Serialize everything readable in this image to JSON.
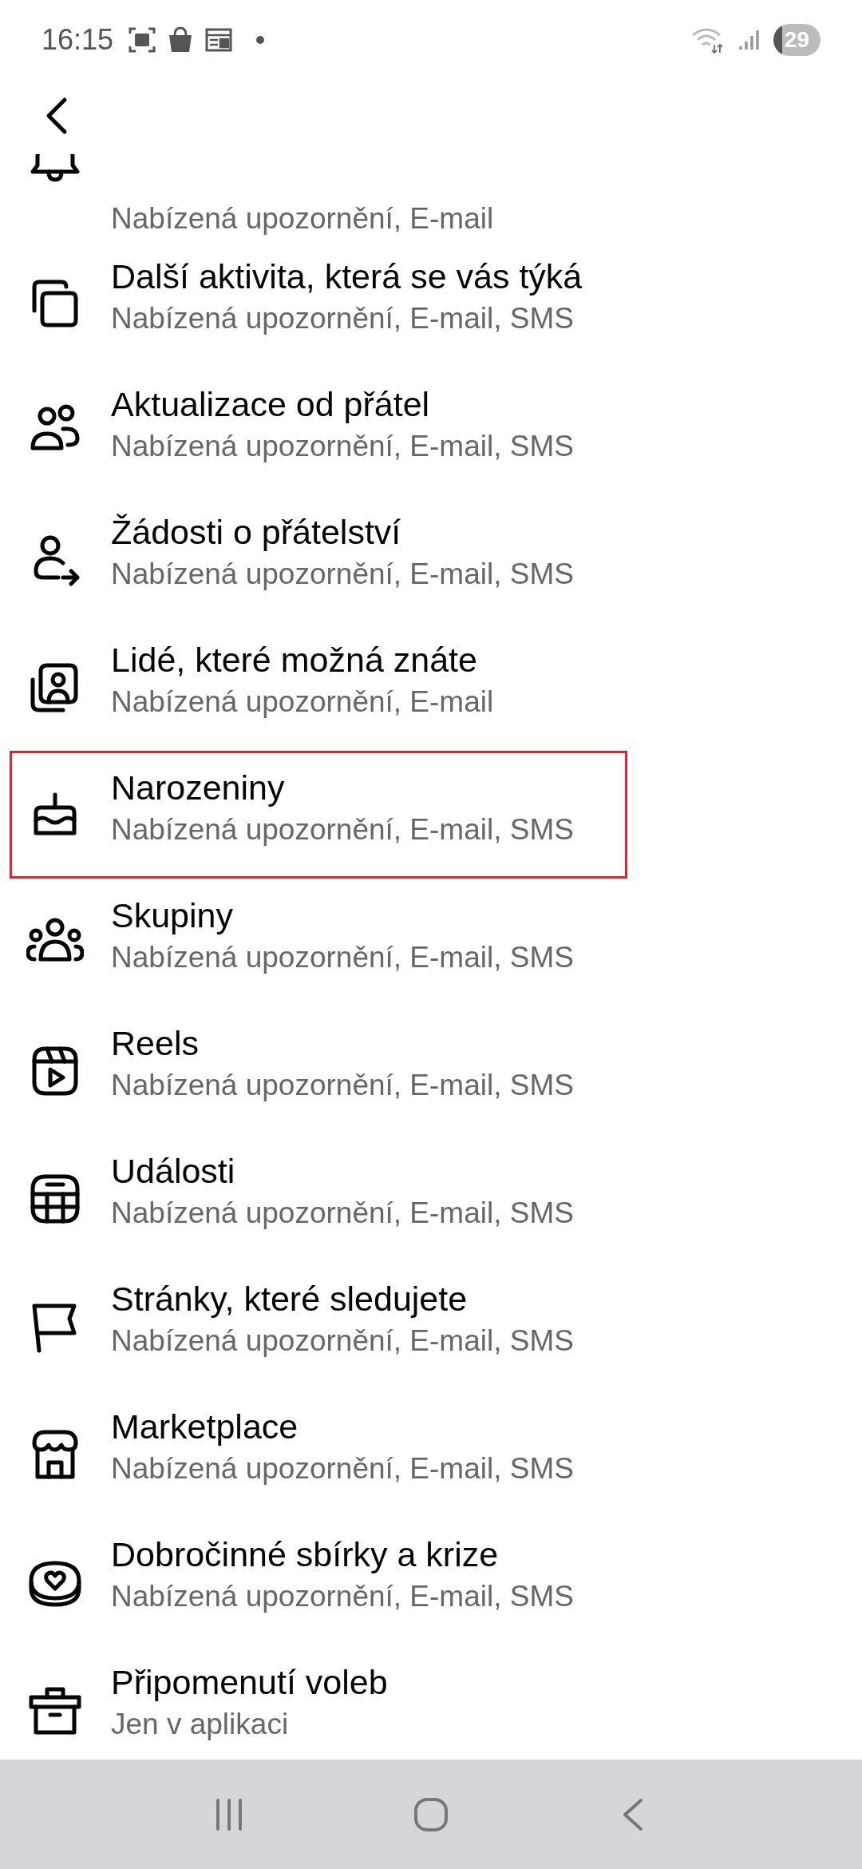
{
  "status_bar": {
    "time": "16:15",
    "battery": "29"
  },
  "items": [
    {
      "subtitle": "Nabízená upozornění, E-mail",
      "highlighted": false
    },
    {
      "title": "Další aktivita, která se vás týká",
      "subtitle": "Nabízená upozornění, E-mail, SMS",
      "highlighted": false
    },
    {
      "title": "Aktualizace od přátel",
      "subtitle": "Nabízená upozornění, E-mail, SMS",
      "highlighted": false
    },
    {
      "title": "Žádosti o přátelství",
      "subtitle": "Nabízená upozornění, E-mail, SMS",
      "highlighted": false
    },
    {
      "title": "Lidé, které možná znáte",
      "subtitle": "Nabízená upozornění, E-mail",
      "highlighted": false
    },
    {
      "title": "Narozeniny",
      "subtitle": "Nabízená upozornění, E-mail, SMS",
      "highlighted": true
    },
    {
      "title": "Skupiny",
      "subtitle": "Nabízená upozornění, E-mail, SMS",
      "highlighted": false
    },
    {
      "title": "Reels",
      "subtitle": "Nabízená upozornění, E-mail, SMS",
      "highlighted": false
    },
    {
      "title": "Události",
      "subtitle": "Nabízená upozornění, E-mail, SMS",
      "highlighted": false
    },
    {
      "title": "Stránky, které sledujete",
      "subtitle": "Nabízená upozornění, E-mail, SMS",
      "highlighted": false
    },
    {
      "title": "Marketplace",
      "subtitle": "Nabízená upozornění, E-mail, SMS",
      "highlighted": false
    },
    {
      "title": "Dobročinné sbírky a krize",
      "subtitle": "Nabízená upozornění, E-mail, SMS",
      "highlighted": false
    },
    {
      "title": "Připomenutí voleb",
      "subtitle": "Jen v aplikaci",
      "highlighted": false
    }
  ]
}
